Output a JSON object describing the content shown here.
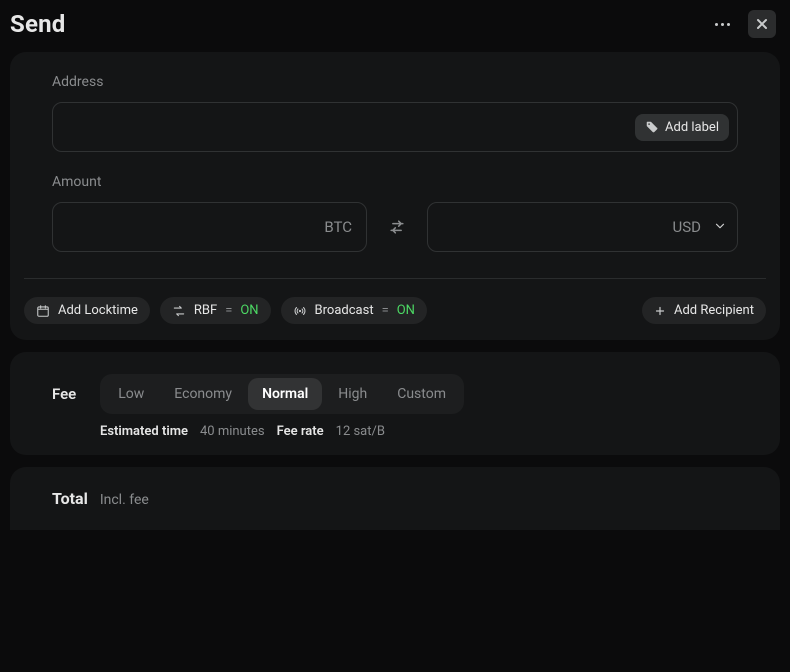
{
  "header": {
    "title": "Send"
  },
  "form": {
    "address": {
      "label": "Address",
      "add_label_button": "Add label"
    },
    "amount": {
      "label": "Amount",
      "primary_unit": "BTC",
      "secondary_unit": "USD"
    }
  },
  "actions": {
    "locktime": {
      "label": "Add Locktime"
    },
    "rbf": {
      "label": "RBF",
      "equals": "=",
      "state": "ON"
    },
    "broadcast": {
      "label": "Broadcast",
      "equals": "=",
      "state": "ON"
    },
    "add_recipient": {
      "label": "Add Recipient"
    }
  },
  "fee": {
    "title": "Fee",
    "options": [
      "Low",
      "Economy",
      "Normal",
      "High",
      "Custom"
    ],
    "selected_index": 2,
    "estimated_time_label": "Estimated time",
    "estimated_time_value": "40 minutes",
    "fee_rate_label": "Fee rate",
    "fee_rate_value": "12 sat/B"
  },
  "total": {
    "title": "Total",
    "incl_fee": "Incl. fee"
  }
}
